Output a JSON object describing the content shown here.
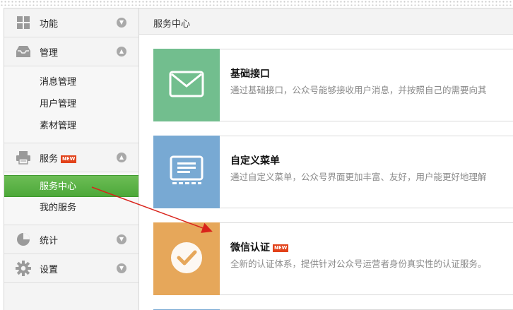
{
  "sidebar": {
    "groups": [
      {
        "label": "功能",
        "icon": "grid-icon"
      },
      {
        "label": "管理",
        "icon": "inbox-icon",
        "items": [
          "消息管理",
          "用户管理",
          "素材管理"
        ]
      },
      {
        "label": "服务",
        "icon": "printer-icon",
        "badge": "NEW",
        "items": [
          "服务中心",
          "我的服务"
        ],
        "active_item": "服务中心"
      },
      {
        "label": "统计",
        "icon": "pie-chart-icon"
      },
      {
        "label": "设置",
        "icon": "gear-icon"
      }
    ]
  },
  "header": {
    "title": "服务中心"
  },
  "cards": [
    {
      "title": "基础接口",
      "desc": "通过基础接口，公众号能够接收用户消息，并按照自己的需要向其",
      "icon": "envelope-icon",
      "color": "#72be8e"
    },
    {
      "title": "自定义菜单",
      "desc": "通过自定义菜单，公众号界面更加丰富、友好，用户能更好地理解",
      "icon": "monitor-icon",
      "color": "#78a9d3"
    },
    {
      "title": "微信认证",
      "badge": "NEW",
      "desc": "全新的认证体系，提供针对公众号运营者身份真实性的认证服务。",
      "icon": "checkmark-icon",
      "color": "#e6a75a"
    }
  ],
  "annotation": {
    "color": "#d9231b"
  }
}
